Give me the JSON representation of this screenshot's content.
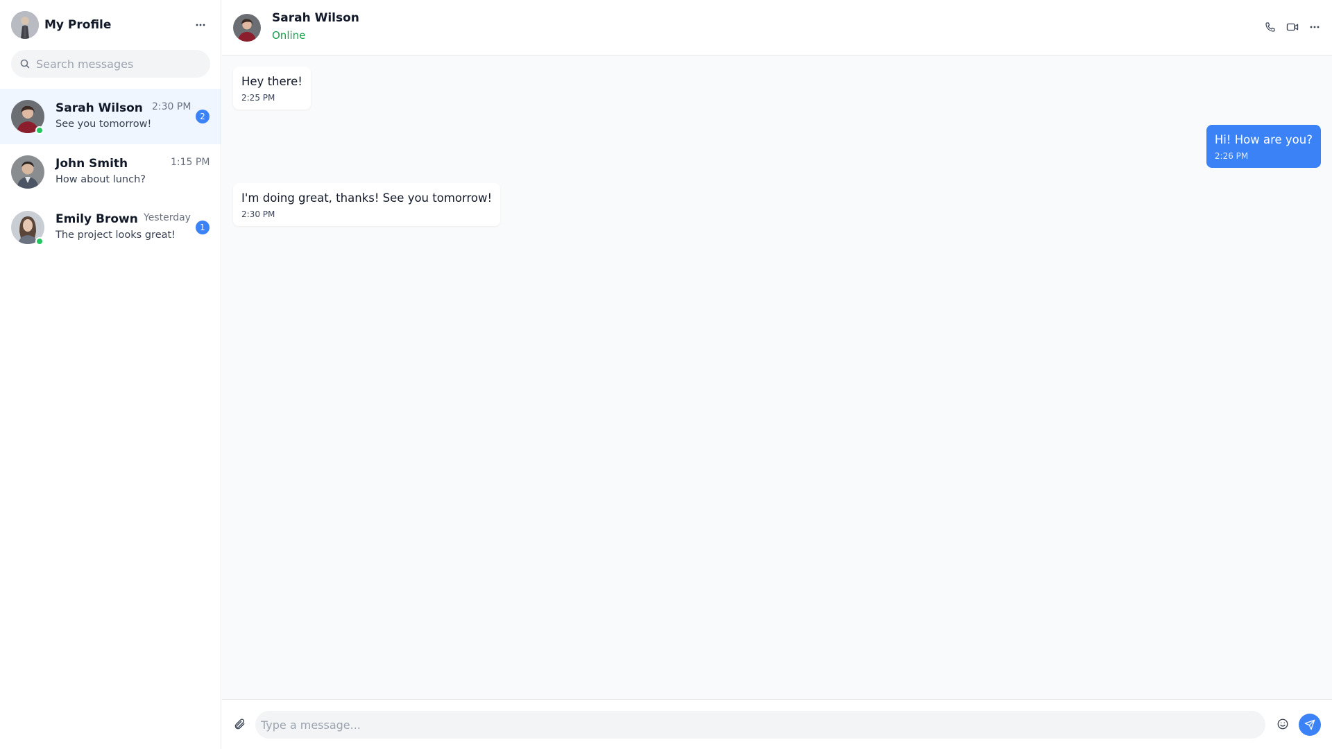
{
  "sidebar": {
    "profile": {
      "name": "My Profile",
      "avatar_icon": "user-avatar"
    },
    "more_icon": "ellipsis-icon",
    "search": {
      "placeholder": "Search messages",
      "value": "",
      "icon": "search-icon"
    },
    "conversations": [
      {
        "name": "Sarah Wilson",
        "time": "2:30 PM",
        "preview": "See you tomorrow!",
        "unread": "2",
        "online": true,
        "active": true
      },
      {
        "name": "John Smith",
        "time": "1:15 PM",
        "preview": "How about lunch?",
        "unread": "",
        "online": false,
        "active": false
      },
      {
        "name": "Emily Brown",
        "time": "Yesterday",
        "preview": "The project looks great!",
        "unread": "1",
        "online": true,
        "active": false
      }
    ]
  },
  "chat": {
    "header": {
      "name": "Sarah Wilson",
      "status": "Online"
    },
    "actions": [
      "phone-icon",
      "video-icon",
      "ellipsis-icon"
    ],
    "messages": [
      {
        "direction": "in",
        "text": "Hey there!",
        "time": "2:25 PM"
      },
      {
        "direction": "out",
        "text": "Hi! How are you?",
        "time": "2:26 PM"
      },
      {
        "direction": "in",
        "text": "I'm doing great, thanks! See you tomorrow!",
        "time": "2:30 PM"
      }
    ],
    "composer": {
      "placeholder": "Type a message...",
      "value": ""
    }
  },
  "colors": {
    "accent": "#3b82f6",
    "online": "#22c55e",
    "status_text": "#16a34a",
    "active_row": "#eff6ff"
  }
}
